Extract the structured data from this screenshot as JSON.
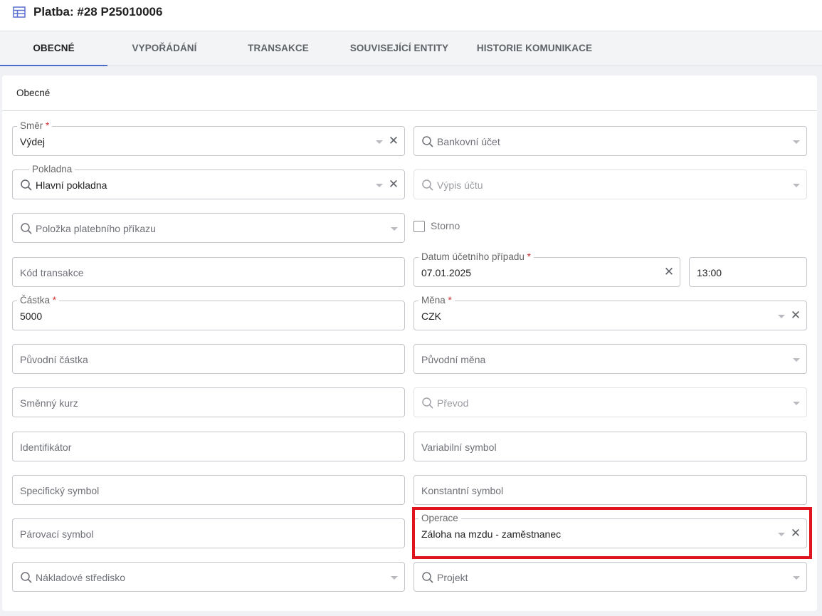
{
  "header": {
    "title": "Platba: #28 P25010006",
    "icon": "table-icon",
    "icon_color": "#5a6fcf"
  },
  "tabs": [
    {
      "label": "OBECNÉ",
      "active": true
    },
    {
      "label": "VYPOŘÁDÁNÍ",
      "active": false
    },
    {
      "label": "TRANSAKCE",
      "active": false
    },
    {
      "label": "SOUVISEJÍCÍ ENTITY",
      "active": false
    },
    {
      "label": "HISTORIE KOMUNIKACE",
      "active": false
    }
  ],
  "section": {
    "title": "Obecné"
  },
  "fields": {
    "smer": {
      "label": "Směr",
      "required_mark": "*",
      "value": "Výdej"
    },
    "bankovni_ucet": {
      "placeholder": "Bankovní účet"
    },
    "pokladna": {
      "label": "Pokladna",
      "value": "Hlavní pokladna"
    },
    "vypis_uctu": {
      "placeholder": "Výpis účtu"
    },
    "polozka": {
      "placeholder": "Položka platebního příkazu"
    },
    "storno": {
      "label": "Storno",
      "checked": false
    },
    "kod_transakce": {
      "placeholder": "Kód transakce"
    },
    "datum": {
      "label": "Datum účetního případu",
      "required_mark": "*",
      "value": "07.01.2025"
    },
    "cas": {
      "value": "13:00"
    },
    "castka": {
      "label": "Částka",
      "required_mark": "*",
      "value": "5000"
    },
    "mena": {
      "label": "Měna",
      "required_mark": "*",
      "value": "CZK"
    },
    "puvodni_castka": {
      "placeholder": "Původní částka"
    },
    "puvodni_mena": {
      "placeholder": "Původní měna"
    },
    "smenny_kurz": {
      "placeholder": "Směnný kurz"
    },
    "prevod": {
      "placeholder": "Převod"
    },
    "identifikator": {
      "placeholder": "Identifikátor"
    },
    "variabilni_symbol": {
      "placeholder": "Variabilní symbol"
    },
    "specificky_symbol": {
      "placeholder": "Specifický symbol"
    },
    "konstantni_symbol": {
      "placeholder": "Konstantní symbol"
    },
    "parovaci_symbol": {
      "placeholder": "Párovací symbol"
    },
    "operace": {
      "label": "Operace",
      "value": "Záloha na mzdu - zaměstnanec"
    },
    "nakladove_stredisko": {
      "placeholder": "Nákladové středisko"
    },
    "projekt": {
      "placeholder": "Projekt"
    }
  },
  "icons": {
    "clear": "✕",
    "search": "search-icon",
    "dropdown": "chevron-down-icon"
  },
  "colors": {
    "accent": "#4a6fc9",
    "required": "#d32f2f",
    "highlight": "#e0141e"
  }
}
